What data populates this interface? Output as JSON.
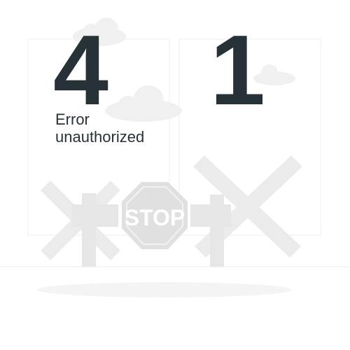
{
  "illustration": {
    "digit_left": "4",
    "digit_right": "1",
    "caption_line1": "Error",
    "caption_line2": "unauthorized",
    "stop_sign_text": "STOP",
    "colors": {
      "digit_text": "#263238",
      "barrier": "#ebebeb",
      "stop_sign": "#e0e0e0",
      "cloud": "#f0f0f0"
    }
  }
}
